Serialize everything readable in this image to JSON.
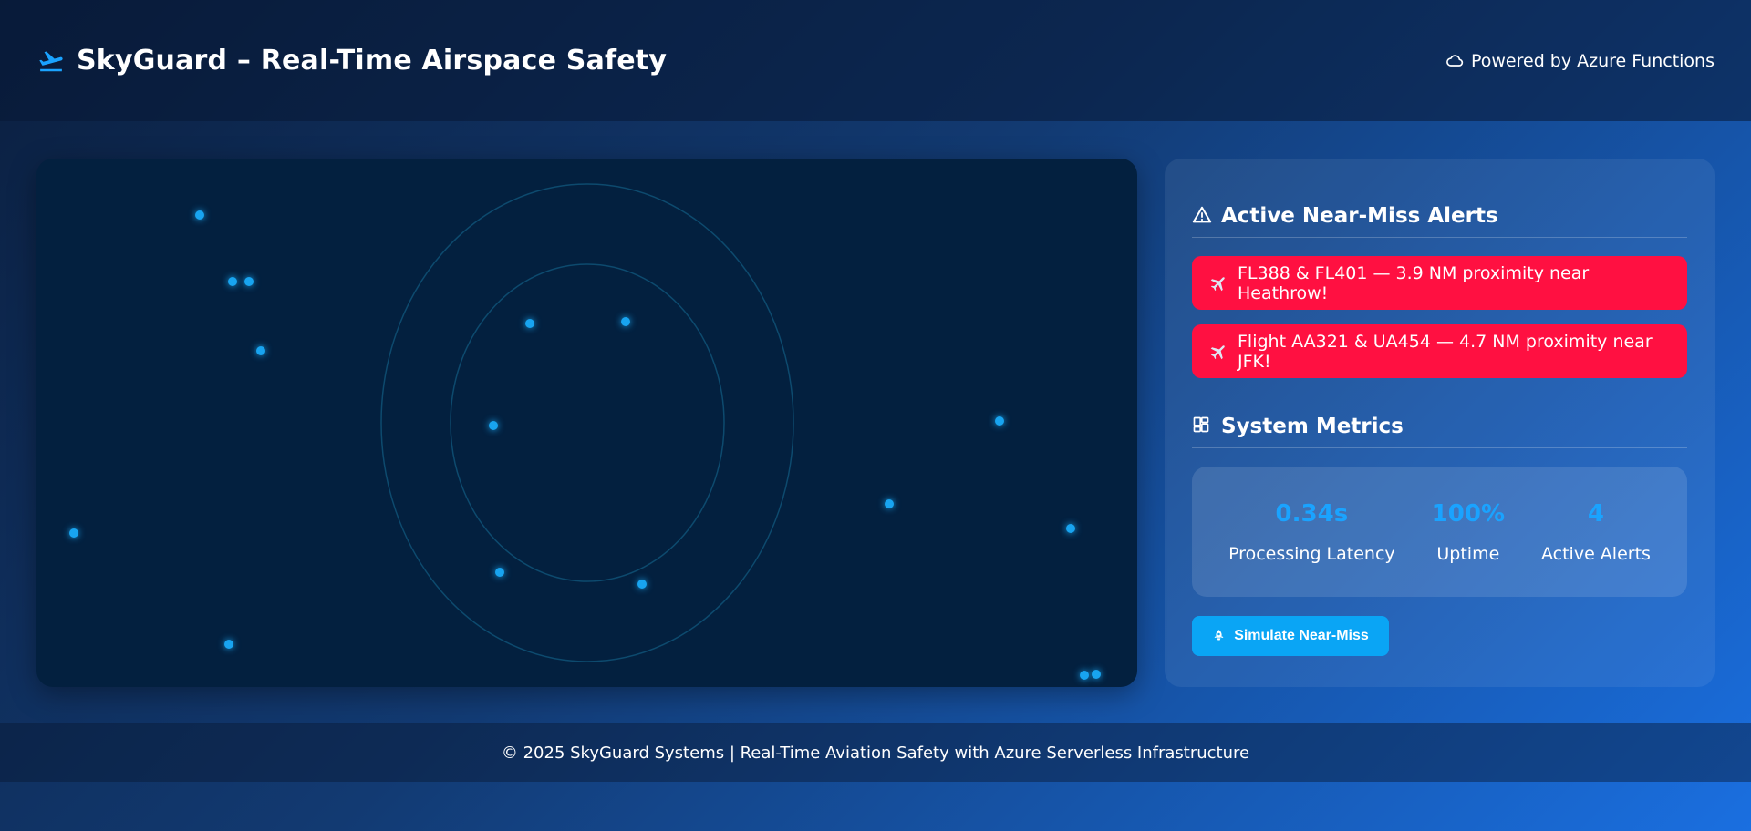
{
  "header": {
    "title": "SkyGuard – Real-Time Airspace Safety",
    "brand_icon": "plane-departure-icon",
    "powered_by": "Powered by Azure Functions",
    "powered_icon": "cloud-icon"
  },
  "radar": {
    "ring_color": "#0d4a6e",
    "aircraft_color": "#18a4f0",
    "aircraft": [
      {
        "id": 1
      },
      {
        "id": 2
      },
      {
        "id": 3
      },
      {
        "id": 4
      },
      {
        "id": 5
      },
      {
        "id": 6
      },
      {
        "id": 7
      },
      {
        "id": 8
      },
      {
        "id": 9
      },
      {
        "id": 10
      },
      {
        "id": 11
      },
      {
        "id": 12
      },
      {
        "id": 13
      },
      {
        "id": 14
      },
      {
        "id": 15
      },
      {
        "id": 16
      }
    ]
  },
  "alerts": {
    "title": "Active Near-Miss Alerts",
    "title_icon": "warning-triangle-icon",
    "color": "#ff1041",
    "items": [
      {
        "text": "FL388 & FL401 — 3.9 NM proximity near Heathrow!",
        "icon": "airplane-icon"
      },
      {
        "text": "Flight AA321 & UA454 — 4.7 NM proximity near JFK!",
        "icon": "airplane-icon"
      }
    ]
  },
  "metrics": {
    "title": "System Metrics",
    "title_icon": "dashboard-icon",
    "accent": "#1aa3ff",
    "items": [
      {
        "value": "0.34s",
        "label": "Processing Latency"
      },
      {
        "value": "100%",
        "label": "Uptime"
      },
      {
        "value": "4",
        "label": "Active Alerts"
      }
    ]
  },
  "simulate_button": {
    "label": "Simulate Near-Miss",
    "icon": "rocket-icon"
  },
  "footer": {
    "text": "© 2025 SkyGuard Systems | Real-Time Aviation Safety with Azure Serverless Infrastructure"
  }
}
